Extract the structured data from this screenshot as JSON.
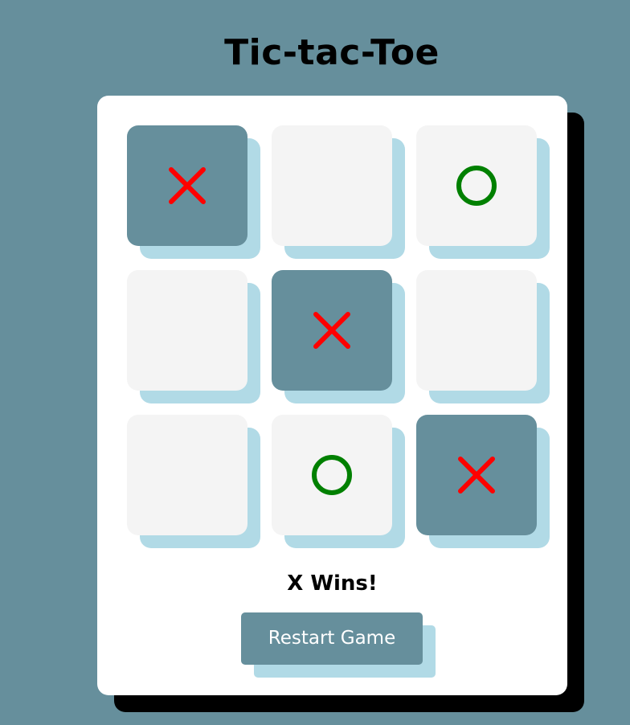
{
  "title": "Tic-tac-Toe",
  "board": [
    {
      "mark": "X",
      "highlight": true
    },
    {
      "mark": "",
      "highlight": false
    },
    {
      "mark": "O",
      "highlight": false
    },
    {
      "mark": "",
      "highlight": false
    },
    {
      "mark": "X",
      "highlight": true
    },
    {
      "mark": "",
      "highlight": false
    },
    {
      "mark": "",
      "highlight": false
    },
    {
      "mark": "O",
      "highlight": false
    },
    {
      "mark": "X",
      "highlight": true
    }
  ],
  "status": "X Wins!",
  "restart_label": "Restart Game",
  "colors": {
    "background": "#668f9c",
    "x_mark": "#ff0000",
    "o_mark": "#008000",
    "cell": "#f4f4f4",
    "winning_cell": "#668f9c",
    "cell_shadow": "#b1dae6"
  }
}
